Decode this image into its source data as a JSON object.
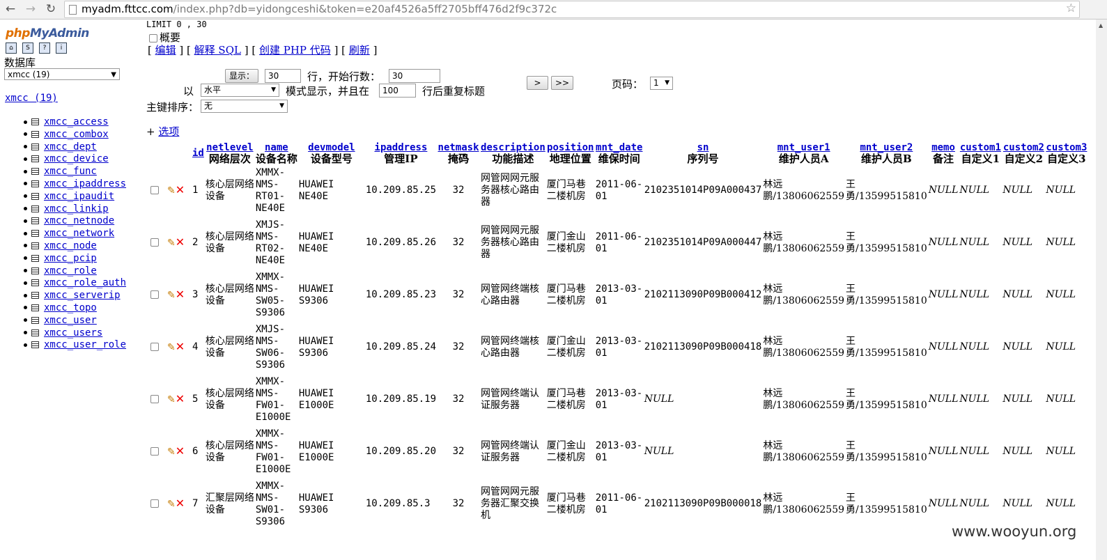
{
  "browser": {
    "back_icon": "←",
    "forward_icon": "→",
    "reload_icon": "↻",
    "url_host": "myadm.fttcc.com",
    "url_rest": "/index.php?db=yidongceshi&token=e20af4526a5ff2705bff476d2f9c372c",
    "star_icon": "☆"
  },
  "left": {
    "logo_a": "php",
    "logo_b": "MyAdmin",
    "db_label": "数据库",
    "db_select": "xmcc (19)",
    "db_link": "xmcc (19)",
    "tables": [
      "xmcc_access",
      "xmcc_combox",
      "xmcc_dept",
      "xmcc_device",
      "xmcc_func",
      "xmcc_ipaddress",
      "xmcc_ipaudit",
      "xmcc_linkip",
      "xmcc_netnode",
      "xmcc_network",
      "xmcc_node",
      "xmcc_pcip",
      "xmcc_role",
      "xmcc_role_auth",
      "xmcc_serverip",
      "xmcc_topo",
      "xmcc_user",
      "xmcc_users",
      "xmcc_user_role"
    ]
  },
  "main": {
    "limit_text": "LIMIT 0 , 30",
    "summary_label": "概要",
    "link_edit": "编辑",
    "link_explain": "解释 SQL",
    "link_php": "创建 PHP 代码",
    "link_refresh": "刷新",
    "show_button": "显示：",
    "rows_value": "30",
    "rows_label": "行，开始行数：",
    "start_value": "30",
    "mode_prefix": "以",
    "mode_select": "水平",
    "mode_label": "模式显示，并且在",
    "repeat_value": "100",
    "repeat_label": "行后重复标题",
    "next_button": ">",
    "last_button": ">>",
    "page_label": "页码：",
    "page_select": "1",
    "sort_label": "主键排序：",
    "sort_select": "无",
    "options_plus": "+",
    "options_link": "选项",
    "watermark": "www.wooyun.org"
  },
  "table": {
    "headers": [
      {
        "link": "id",
        "label": ""
      },
      {
        "link": "netlevel",
        "label": "网络层次"
      },
      {
        "link": "name",
        "label": "设备名称"
      },
      {
        "link": "devmodel",
        "label": "设备型号"
      },
      {
        "link": "ipaddress",
        "label": "管理IP"
      },
      {
        "link": "netmask",
        "label": "掩码"
      },
      {
        "link": "description",
        "label": "功能描述"
      },
      {
        "link": "position",
        "label": "地理位置"
      },
      {
        "link": "mnt_date",
        "label": "维保时间"
      },
      {
        "link": "sn",
        "label": "序列号"
      },
      {
        "link": "mnt_user1",
        "label": "维护人员A"
      },
      {
        "link": "mnt_user2",
        "label": "维护人员B"
      },
      {
        "link": "memo",
        "label": "备注"
      },
      {
        "link": "custom1",
        "label": "自定义1"
      },
      {
        "link": "custom2",
        "label": "自定义2"
      },
      {
        "link": "custom3",
        "label": "自定义3"
      }
    ],
    "rows": [
      {
        "id": "1",
        "netlevel": "核心层网络设备",
        "name": "XMMX-NMS-RT01-NE40E",
        "devmodel": "HUAWEI NE40E",
        "ip": "10.209.85.25",
        "mask": "32",
        "desc": "网管网网元服务器核心路由器",
        "pos": "厦门马巷二楼机房",
        "date": "2011-06-01",
        "sn": "2102351014P09A000437",
        "u1": "林远鹏/13806062559",
        "u2": "王勇/13599515810",
        "memo": "NULL",
        "c1": "NULL",
        "c2": "NULL",
        "c3": "NULL"
      },
      {
        "id": "2",
        "netlevel": "核心层网络设备",
        "name": "XMJS-NMS-RT02-NE40E",
        "devmodel": "HUAWEI NE40E",
        "ip": "10.209.85.26",
        "mask": "32",
        "desc": "网管网网元服务器核心路由器",
        "pos": "厦门金山二楼机房",
        "date": "2011-06-01",
        "sn": "2102351014P09A000447",
        "u1": "林远鹏/13806062559",
        "u2": "王勇/13599515810",
        "memo": "NULL",
        "c1": "NULL",
        "c2": "NULL",
        "c3": "NULL"
      },
      {
        "id": "3",
        "netlevel": "核心层网络设备",
        "name": "XMMX-NMS-SW05-S9306",
        "devmodel": "HUAWEI S9306",
        "ip": "10.209.85.23",
        "mask": "32",
        "desc": "网管网终端核心路由器",
        "pos": "厦门马巷二楼机房",
        "date": "2013-03-01",
        "sn": "2102113090P09B000412",
        "u1": "林远鹏/13806062559",
        "u2": "王勇/13599515810",
        "memo": "NULL",
        "c1": "NULL",
        "c2": "NULL",
        "c3": "NULL"
      },
      {
        "id": "4",
        "netlevel": "核心层网络设备",
        "name": "XMJS-NMS-SW06-S9306",
        "devmodel": "HUAWEI S9306",
        "ip": "10.209.85.24",
        "mask": "32",
        "desc": "网管网终端核心路由器",
        "pos": "厦门金山二楼机房",
        "date": "2013-03-01",
        "sn": "2102113090P09B000418",
        "u1": "林远鹏/13806062559",
        "u2": "王勇/13599515810",
        "memo": "NULL",
        "c1": "NULL",
        "c2": "NULL",
        "c3": "NULL"
      },
      {
        "id": "5",
        "netlevel": "核心层网络设备",
        "name": "XMMX-NMS-FW01-E1000E",
        "devmodel": "HUAWEI E1000E",
        "ip": "10.209.85.19",
        "mask": "32",
        "desc": "网管网终端认证服务器",
        "pos": "厦门马巷二楼机房",
        "date": "2013-03-01",
        "sn": "NULL",
        "u1": "林远鹏/13806062559",
        "u2": "王勇/13599515810",
        "memo": "NULL",
        "c1": "NULL",
        "c2": "NULL",
        "c3": "NULL"
      },
      {
        "id": "6",
        "netlevel": "核心层网络设备",
        "name": "XMMX-NMS-FW01-E1000E",
        "devmodel": "HUAWEI E1000E",
        "ip": "10.209.85.20",
        "mask": "32",
        "desc": "网管网终端认证服务器",
        "pos": "厦门金山二楼机房",
        "date": "2013-03-01",
        "sn": "NULL",
        "u1": "林远鹏/13806062559",
        "u2": "王勇/13599515810",
        "memo": "NULL",
        "c1": "NULL",
        "c2": "NULL",
        "c3": "NULL"
      },
      {
        "id": "7",
        "netlevel": "汇聚层网络设备",
        "name": "XMMX-NMS-SW01-S9306",
        "devmodel": "HUAWEI S9306",
        "ip": "10.209.85.3",
        "mask": "32",
        "desc": "网管网网元服务器汇聚交换机",
        "pos": "厦门马巷二楼机房",
        "date": "2011-06-01",
        "sn": "2102113090P09B000018",
        "u1": "林远鹏/13806062559",
        "u2": "王勇/13599515810",
        "memo": "NULL",
        "c1": "NULL",
        "c2": "NULL",
        "c3": "NULL"
      }
    ]
  }
}
